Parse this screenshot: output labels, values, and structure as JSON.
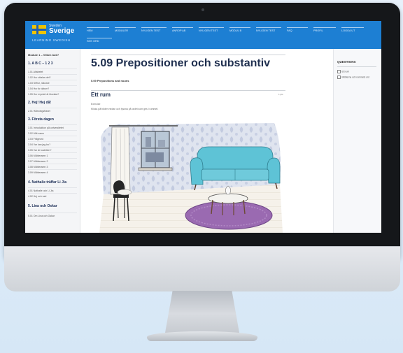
{
  "app": {
    "logo_small": "Sweden",
    "logo_big": "Sverige",
    "logo_tagline": "LEARNING SWEDISH"
  },
  "nav": {
    "items": [
      "HEM",
      "MODULER",
      "NYLIGEN TEST",
      "ANROP AB",
      "NYLIGEN TEST",
      "MODUL B",
      "NYLIGEN TEST",
      "FAQ",
      "PROFIL",
      "LOGGA UT"
    ],
    "sub": "SÖK ORD"
  },
  "sidebar": {
    "module_title": "Module 1 – Vilken bok?",
    "sections": [
      {
        "title": "1. A B C – 1 2 3",
        "links": [
          "1.01 Alfabetet",
          "1.02 Hur uttalas det?",
          "1.03 Siffror, räknare",
          "1.04 Hur är datum?",
          "1.05 Hur mycket är klockan?"
        ]
      },
      {
        "title": "2. Hej! Hej då!",
        "links": [
          "2.01 Hälsningsfraser"
        ]
      },
      {
        "title": "3. Första dagen",
        "links": [
          "3.01 Introduktion på universitetet",
          "3.02 Mitt namn",
          "3.03 Frågeord",
          "3.04 Var kan jag bo?",
          "3.05 Var är toaletten?",
          "3.06 Möbleraren 1",
          "3.07 Möbleraren 2",
          "3.08 Möbleraren 3",
          "3.09 Möbleraren 4"
        ]
      },
      {
        "title": "4. Nathalie träffar Li Jia",
        "links": [
          "4.01 Nathalie och Li Jia",
          "4.02 Hej och vad"
        ]
      },
      {
        "title": "5. Lina och Oskar",
        "links": [
          "5.01 Om Lina och Oskar"
        ]
      }
    ]
  },
  "main": {
    "page_title": "5.09 Prepositioner och substantiv",
    "subtitle": "5.09 Prepositions and nouns",
    "exercise_title": "Ett rum",
    "exercise_meta": "1 pts",
    "exercise_label": "Exercise",
    "instruction": "Klicka på bilden nedan och lyssna på ordet som ges i rummet."
  },
  "questions": {
    "heading": "QUESTIONS",
    "items": [
      "Ett rum",
      "Möblerna och rummets ord"
    ]
  },
  "colors": {
    "accent": "#1d7fd3",
    "sofa": "#5ec3d6",
    "rug": "#9a6ab1",
    "wall": "#cfd6e8"
  }
}
